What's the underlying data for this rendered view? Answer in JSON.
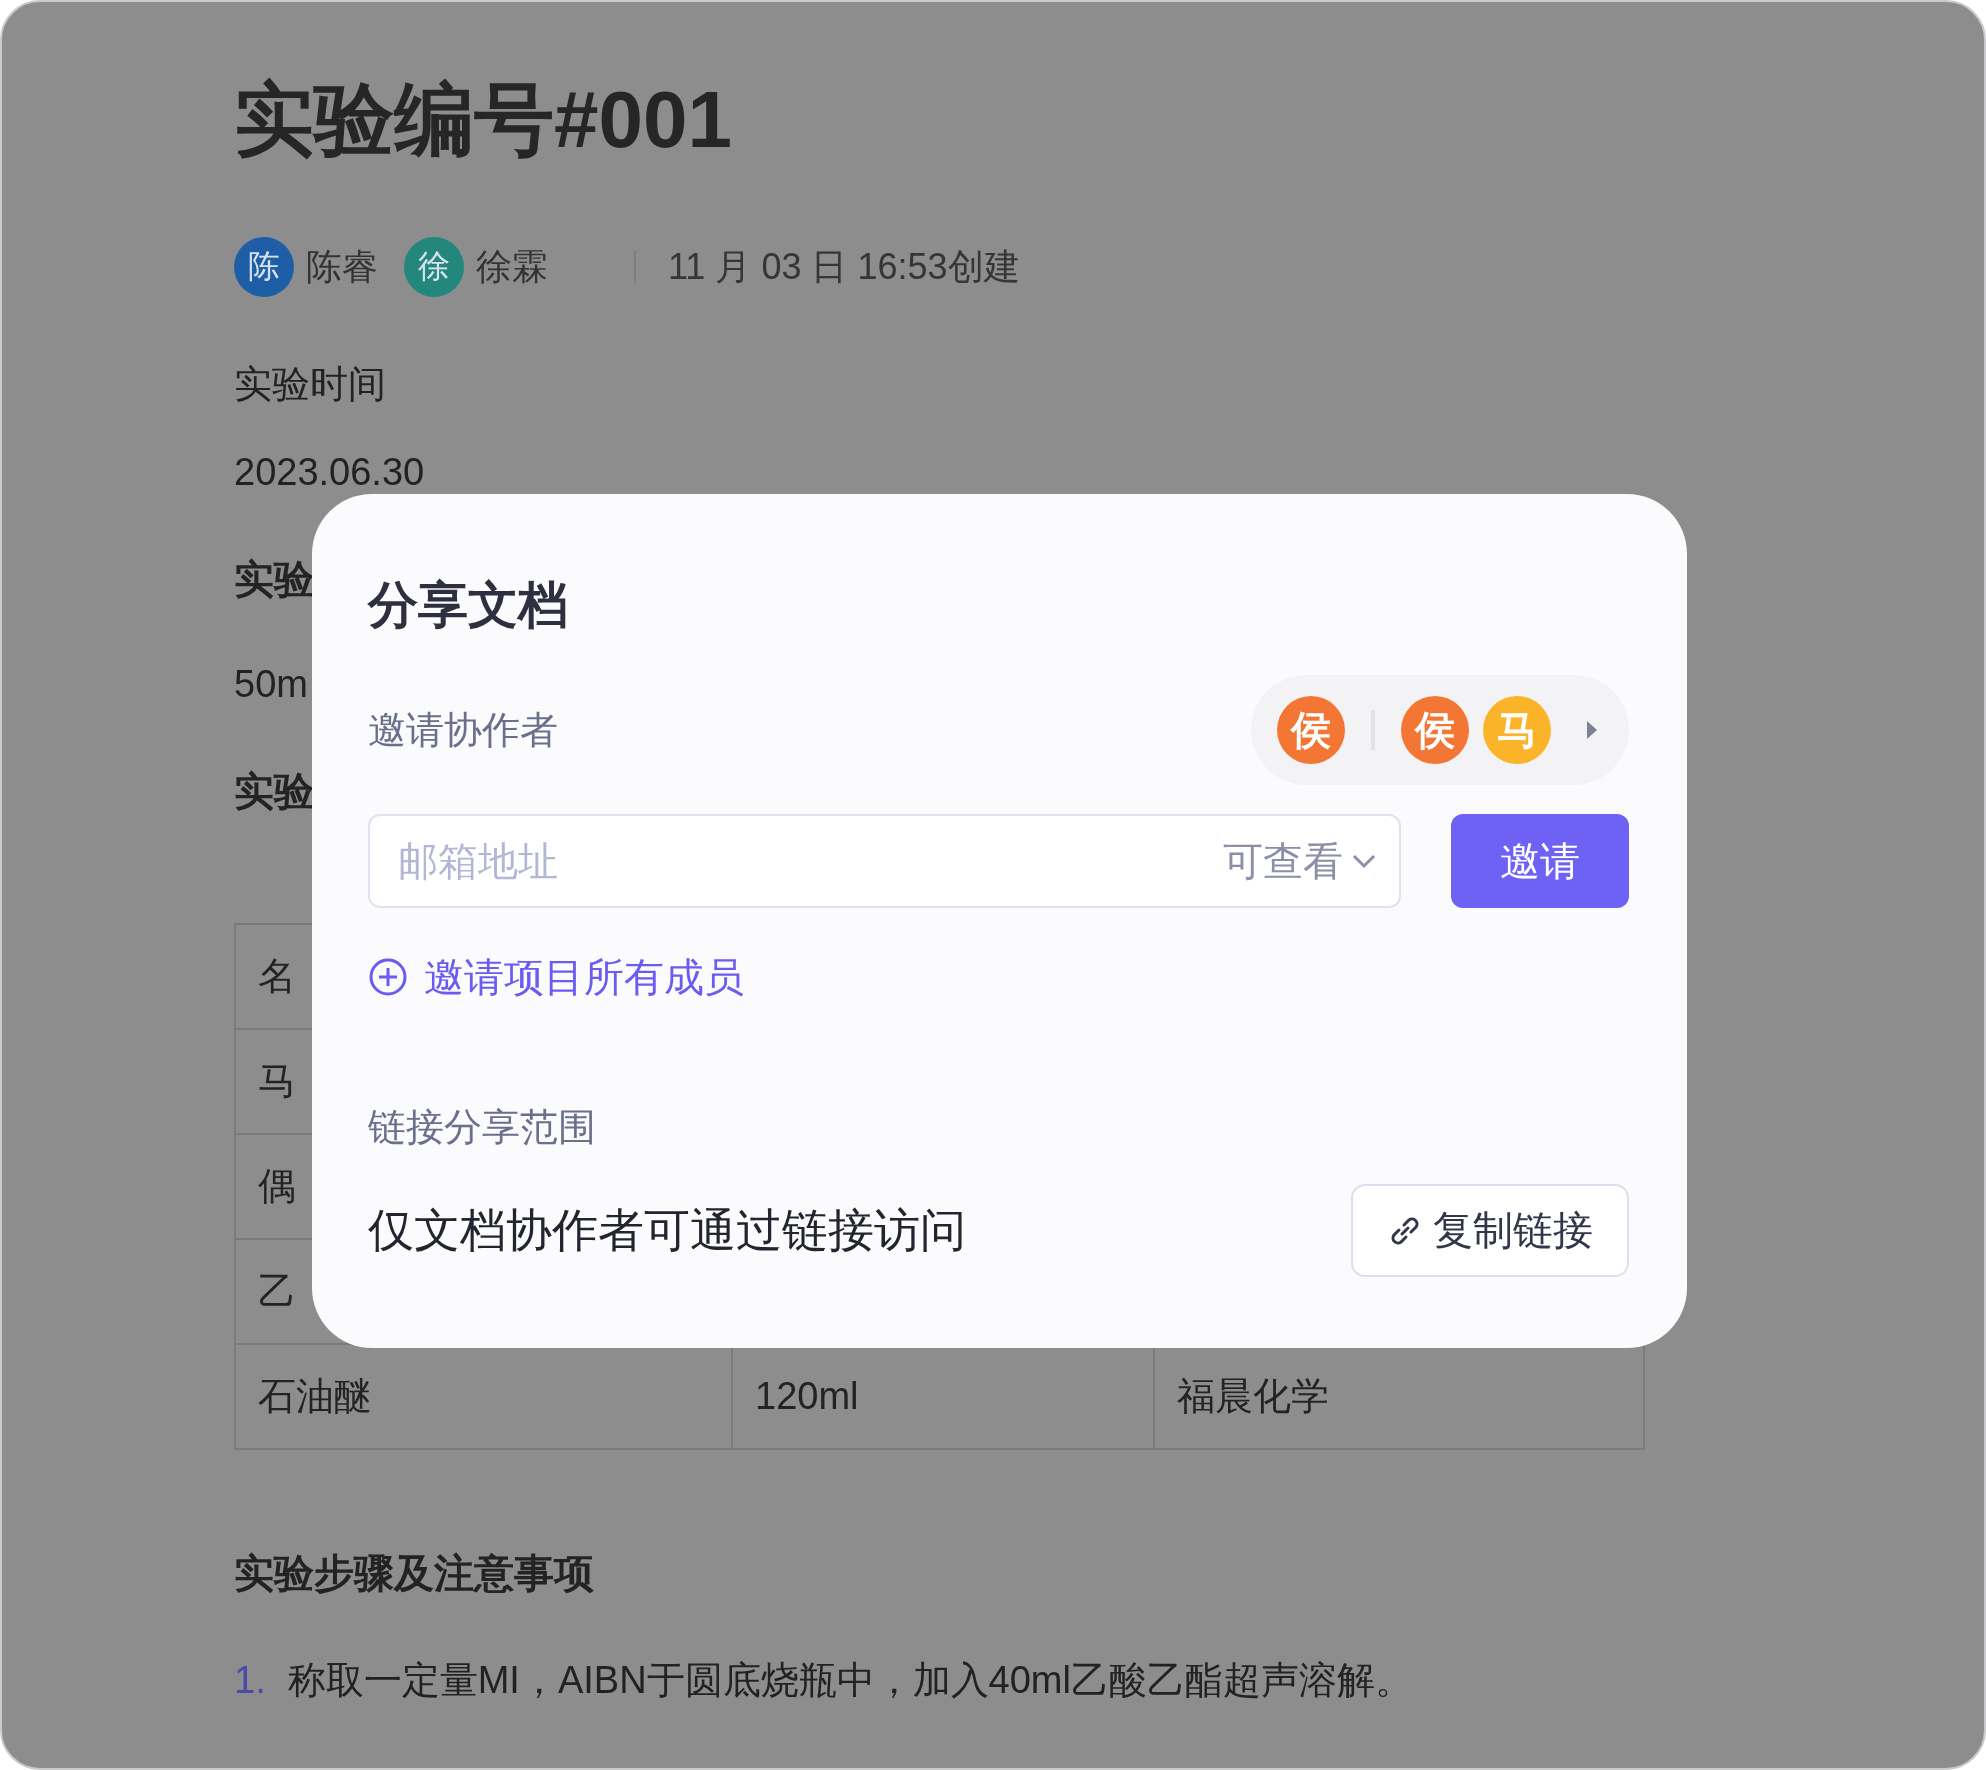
{
  "document": {
    "title": "实验编号#001",
    "authors": [
      {
        "initial": "陈",
        "name": "陈睿",
        "color": "#1d5ea6"
      },
      {
        "initial": "徐",
        "name": "徐霖",
        "color": "#23877e"
      }
    ],
    "created": "11 月 03 日 16:53创建",
    "blocks": [
      {
        "kind": "text",
        "text": "实验时间"
      },
      {
        "kind": "text",
        "text": "2023.06.30"
      },
      {
        "kind": "heading",
        "text": "实验"
      },
      {
        "kind": "text",
        "text": "50m"
      },
      {
        "kind": "heading",
        "text": "实验"
      },
      {
        "kind": "table",
        "rows": [
          [
            "名"
          ],
          [
            "马"
          ],
          [
            "偶"
          ],
          [
            "乙"
          ],
          [
            "石油醚",
            "120ml",
            "福晨化学"
          ]
        ]
      },
      {
        "kind": "heading",
        "text": "实验步骤及注意事项"
      },
      {
        "kind": "list_item",
        "number": "1.",
        "text": "称取一定量MI，AIBN于圆底烧瓶中，加入40ml乙酸乙酯超声溶解。"
      }
    ]
  },
  "share_dialog": {
    "title": "分享文档",
    "invite_label": "邀请协作者",
    "owner": {
      "initial": "侯",
      "color": "#f47634"
    },
    "collaborators": [
      {
        "initial": "侯",
        "color": "#f47634"
      },
      {
        "initial": "马",
        "color": "#fbb32a"
      }
    ],
    "email_placeholder": "邮箱地址",
    "permission": "可查看",
    "invite_button": "邀请",
    "invite_all": "邀请项目所有成员",
    "link_scope_label": "链接分享范围",
    "link_scope": "仅文档协作者可通过链接访问",
    "copy_link_button": "复制链接"
  }
}
